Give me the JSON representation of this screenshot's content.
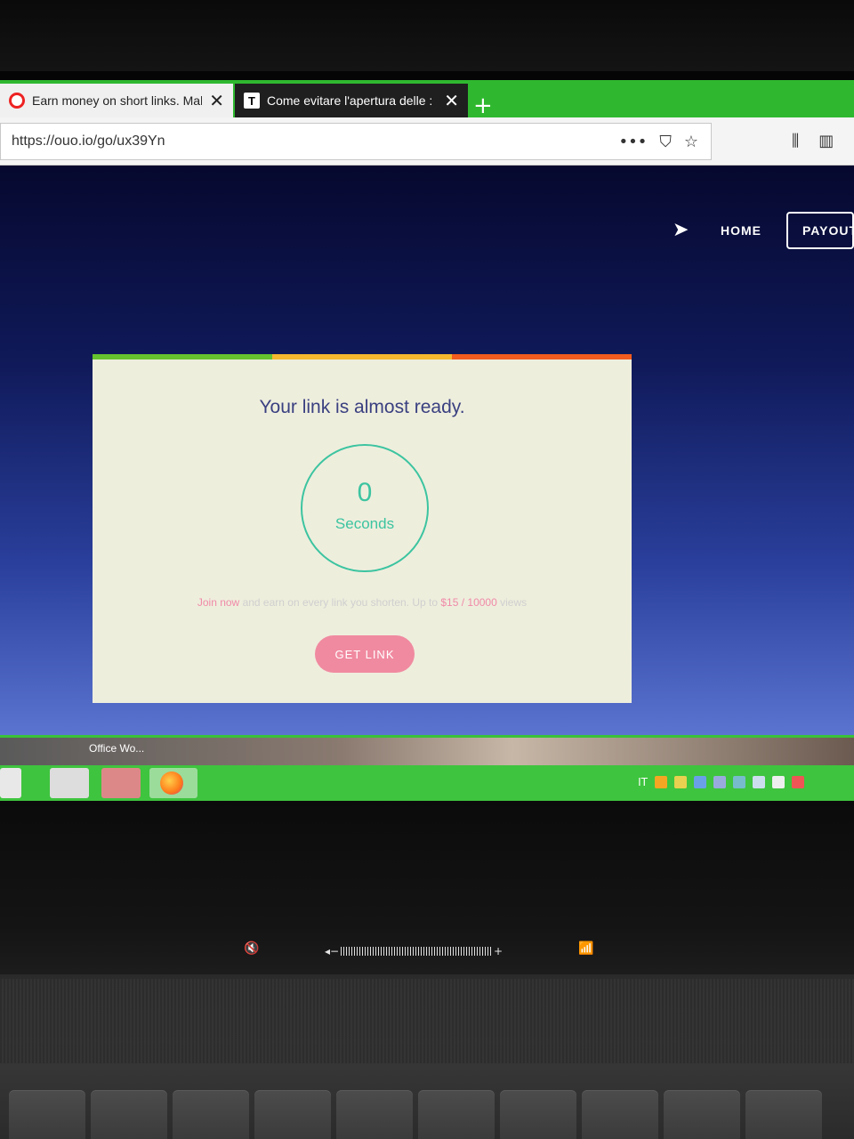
{
  "browser": {
    "tabs": [
      {
        "title": "Earn money on short links. Mak",
        "close": "✕"
      },
      {
        "title": "Come evitare l'apertura delle :",
        "icon_letter": "T",
        "close": "✕"
      }
    ],
    "new_tab": "+",
    "url": "https://ouo.io/go/ux39Yn",
    "url_icons": {
      "more": "•••",
      "pocket": "⛉",
      "star": "☆"
    },
    "toolbar_icons": {
      "library": "⫼",
      "sidebar": "▥"
    }
  },
  "site_nav": {
    "home": "HOME",
    "payout": "PAYOUT"
  },
  "card": {
    "title": "Your link is almost ready.",
    "timer_value": "0",
    "timer_unit": "Seconds",
    "promo": {
      "join": "Join now",
      "mid": " and earn on every link you shorten. Up to ",
      "rate": "$15 / 10000",
      "end": " views"
    },
    "button": "GET LINK"
  },
  "taskbar": {
    "window_label": "Office Wo...",
    "tray_lang": "IT"
  },
  "colors": {
    "accent_green": "#3cc4a0",
    "button_pink": "#f08aa0",
    "bar_green": "#66c22e",
    "bar_yellow": "#f5b82e",
    "bar_orange": "#f25c1e"
  }
}
